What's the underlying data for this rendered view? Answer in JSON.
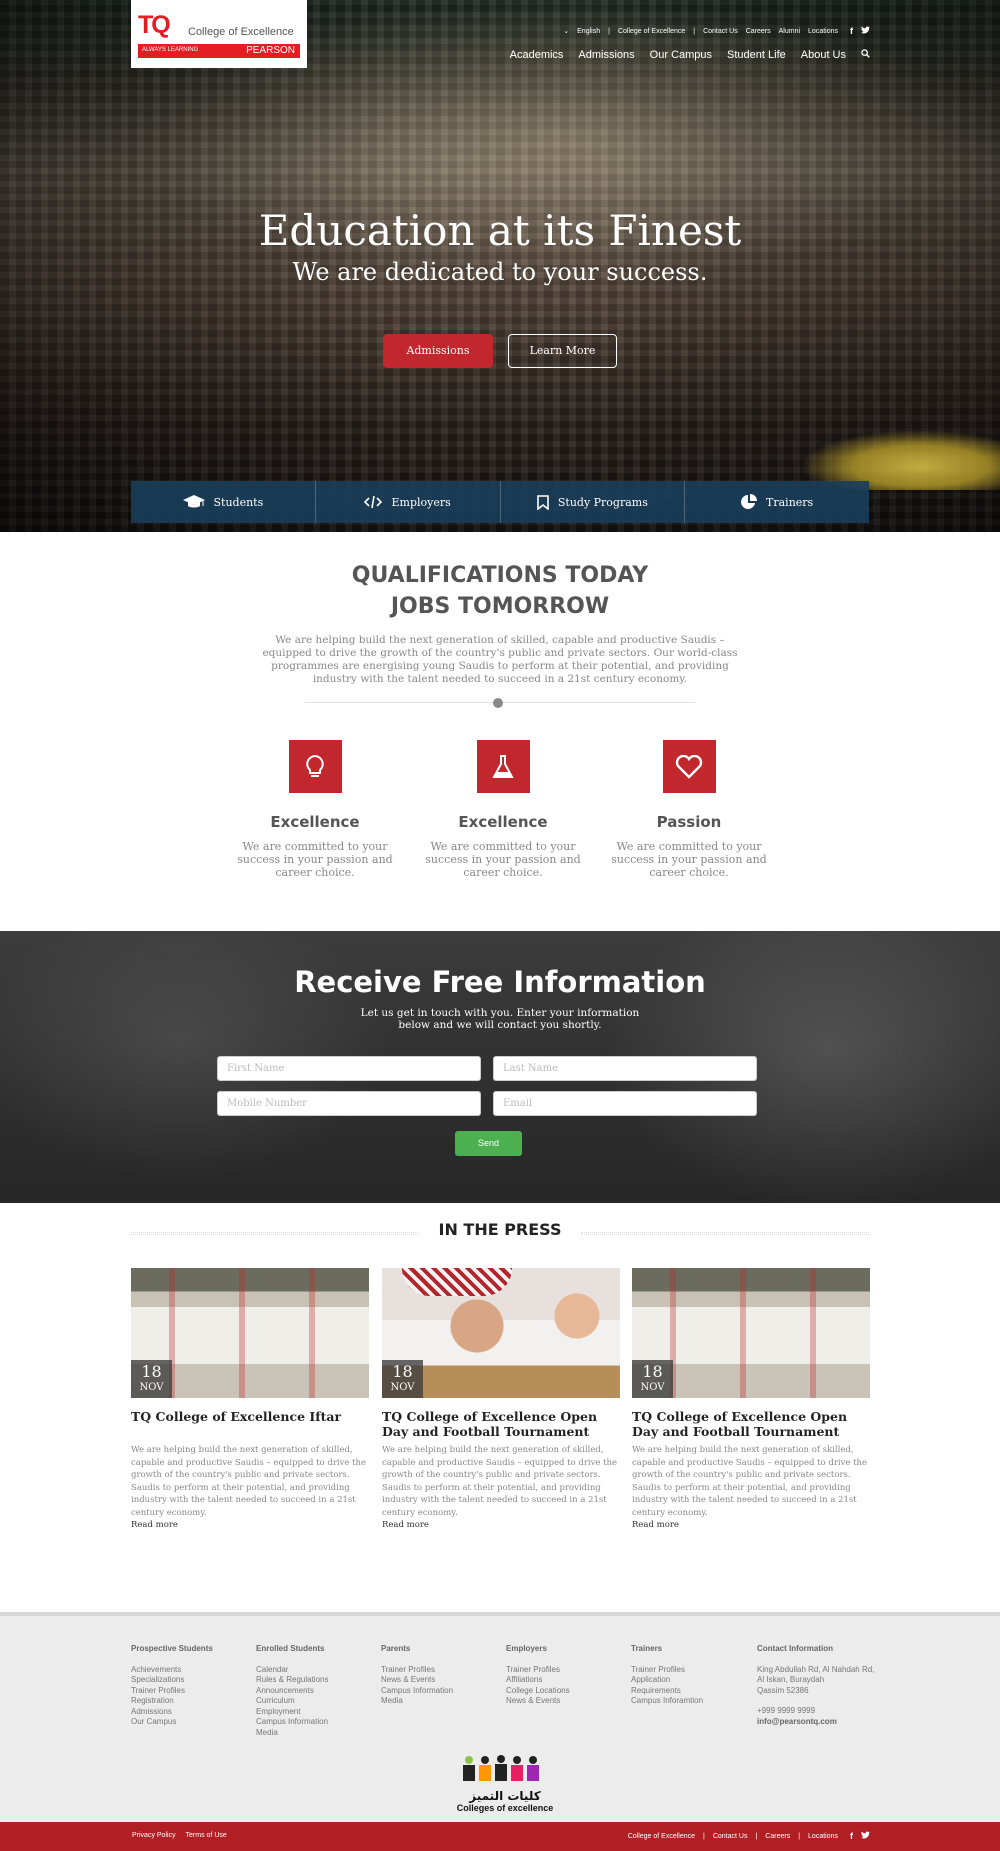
{
  "logo": {
    "mark": "TQ",
    "college": "College of Excellence",
    "tagline": "ALWAYS LEARNING",
    "partner": "PEARSON"
  },
  "utility_nav": {
    "language": "English",
    "links": [
      "College of Excellence",
      "Contact Us",
      "Careers",
      "Alumni",
      "Locations"
    ]
  },
  "main_nav": [
    "Academics",
    "Admissions",
    "Our Campus",
    "Student Life",
    "About Us"
  ],
  "hero": {
    "title": "Education at its Finest",
    "subtitle": "We are dedicated to your success.",
    "primary_button": "Admissions",
    "secondary_button": "Learn More"
  },
  "quick_tabs": [
    {
      "label": "Students",
      "icon": "graduation-cap-icon"
    },
    {
      "label": "Employers",
      "icon": "code-icon"
    },
    {
      "label": "Study Programs",
      "icon": "bookmark-icon"
    },
    {
      "label": "Trainers",
      "icon": "pie-chart-icon"
    }
  ],
  "intro": {
    "title_line1": "QUALIFICATIONS TODAY",
    "title_line2": "JOBS TOMORROW",
    "text": "We are helping build the next generation of skilled, capable and productive Saudis – equipped to drive the growth of the country's public and private sectors. Our world-class programmes are energising young Saudis to perform at their potential, and providing industry with the talent needed to succeed in a 21st century economy."
  },
  "features": [
    {
      "title": "Excellence",
      "text": "We are committed to your success in your passion and career choice.",
      "icon": "lightbulb-icon"
    },
    {
      "title": "Excellence",
      "text": "We are committed to your success in your passion and career choice.",
      "icon": "flask-icon"
    },
    {
      "title": "Passion",
      "text": "We are committed to your success in your passion and career choice.",
      "icon": "heart-icon"
    }
  ],
  "info_form": {
    "title": "Receive Free Information",
    "text_line1": "Let us get in touch with you.  Enter your information",
    "text_line2": "below and we will contact you shortly.",
    "first_name_placeholder": "First Name",
    "last_name_placeholder": "Last Name",
    "mobile_placeholder": "Mobile Number",
    "email_placeholder": "Email",
    "send_label": "Send"
  },
  "press": {
    "title": "IN THE PRESS",
    "articles": [
      {
        "day": "18",
        "month": "NOV",
        "title": "TQ College of Excellence Iftar",
        "text": "We are helping build the next generation of skilled, capable and productive Saudis – equipped to drive the growth of the country's public and private sectors. Saudis to perform at their potential, and providing industry with the talent needed to succeed in a 21st century economy.",
        "link": "Read more"
      },
      {
        "day": "18",
        "month": "NOV",
        "title": "TQ College of Excellence Open Day and Football Tournament",
        "text": "We are helping build the next generation of skilled, capable and productive Saudis – equipped to drive the growth of the country's public and private sectors. Saudis to perform at their potential, and providing industry with the talent needed to succeed in a 21st century economy.",
        "link": "Read more"
      },
      {
        "day": "18",
        "month": "NOV",
        "title": "TQ College of Excellence Open Day and Football Tournament",
        "text": "We are helping build the next generation of skilled, capable and productive Saudis – equipped to drive the growth of the country's public and private sectors. Saudis to perform at their potential, and providing industry with the talent needed to succeed in a 21st century economy.",
        "link": "Read more"
      }
    ]
  },
  "footer": {
    "columns": [
      {
        "title": "Prospective Students",
        "links": [
          "Achievements",
          "Specializations",
          "Trainer Profiles",
          "Registration",
          "Admissions",
          "Our Campus"
        ]
      },
      {
        "title": "Enrolled Students",
        "links": [
          "Calendar",
          "Rules & Regulations",
          "Announcements",
          "Curriculum",
          "Employment",
          "Campus Information",
          "Media"
        ]
      },
      {
        "title": "Parents",
        "links": [
          "Trainer Profiles",
          "News & Events",
          "Campus Information",
          "Media"
        ]
      },
      {
        "title": "Employers",
        "links": [
          "Trainer Profiles",
          "Affiliations",
          "College Locations",
          "News & Events"
        ]
      },
      {
        "title": "Trainers",
        "links": [
          "Trainer Profiles",
          "Application",
          "Requirements",
          "Campus Inforamtion"
        ]
      }
    ],
    "contact": {
      "title": "Contact Information",
      "address1": "King Abdullah Rd, Al Nahdah Rd,",
      "address2": "Al Iskan, Buraydah",
      "address3": "Qassim 52386",
      "phone": "+999 9999 9999",
      "email": "info@pearsontq.com"
    },
    "logo_arabic": "كليات التميز",
    "logo_english": "Colleges of excellence"
  },
  "bottom_bar": {
    "privacy": "Privacy Policy",
    "terms": "Terms of Use",
    "links": [
      "College of Excellence",
      "Contact Us",
      "Careers",
      "Locations"
    ]
  },
  "colors": {
    "brand_red": "#c1272d",
    "pearson_red": "#e41c23",
    "tab_bar": "#193e5a",
    "send_green": "#4caf50",
    "footer_bar": "#b11f25"
  }
}
